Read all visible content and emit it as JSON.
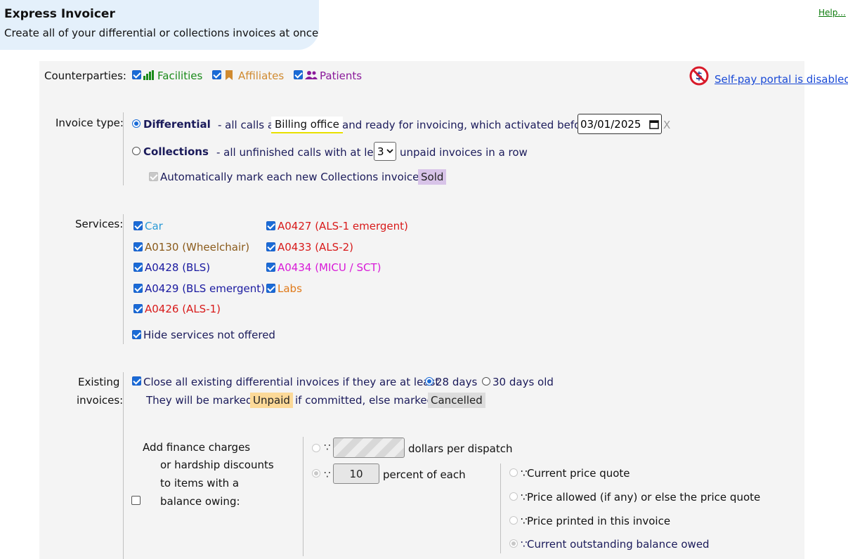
{
  "header": {
    "title": "Express Invoicer",
    "subtitle": "Create all of your differential or collections invoices at once",
    "help_link": "Help..."
  },
  "counterparties": {
    "label": "Counterparties:",
    "items": [
      {
        "label": "Facilities",
        "checked": true,
        "color": "#1a8a1a"
      },
      {
        "label": "Affiliates",
        "checked": true,
        "color": "#d08a30"
      },
      {
        "label": "Patients",
        "checked": true,
        "color": "#8a1a9a"
      }
    ],
    "selfpay_link": "Self-pay portal is disabled"
  },
  "invoice_type": {
    "label": "Invoice type:",
    "differential": {
      "title": "Differential",
      "text1": "- all calls at",
      "location": "Billing office",
      "text2": "and ready for invoicing, which activated before",
      "date": "03/01/2025",
      "clear": "X",
      "selected": true
    },
    "collections": {
      "title": "Collections",
      "text1": "- all unfinished calls with at least",
      "count": "3",
      "text2": "unpaid invoices in a row",
      "selected": false
    },
    "auto_mark": {
      "text": "Automatically mark each new Collections invoice as",
      "badge": "Sold"
    }
  },
  "services": {
    "label": "Services:",
    "col1": [
      {
        "label": "Car",
        "color": "#2a9ad6"
      },
      {
        "label": "A0130 (Wheelchair)",
        "color": "#8a5a1a"
      },
      {
        "label": "A0428 (BLS)",
        "color": "#1a1aa0"
      },
      {
        "label": "A0429 (BLS emergent)",
        "color": "#1a1aa0"
      },
      {
        "label": "A0426 (ALS-1)",
        "color": "#d81a1a"
      }
    ],
    "col2": [
      {
        "label": "A0427 (ALS-1 emergent)",
        "color": "#d81a1a"
      },
      {
        "label": "A0433 (ALS-2)",
        "color": "#d81a1a"
      },
      {
        "label": "A0434 (MICU / SCT)",
        "color": "#d81ad8"
      },
      {
        "label": "Labs",
        "color": "#e07a1a"
      }
    ],
    "hide_not_offered": "Hide services not offered"
  },
  "existing": {
    "label_line1": "Existing",
    "label_line2": "invoices:",
    "close_text": "Close all existing differential invoices if they are at least",
    "opt_28": "28 days",
    "opt_30": "30 days old",
    "marked_text1": "They will be marked",
    "unpaid_badge": "Unpaid",
    "marked_text2": "if committed, else marked",
    "cancelled_badge": "Cancelled"
  },
  "finance": {
    "line1": "Add finance charges",
    "line2": "or hardship discounts",
    "line3": "to items with a",
    "line4": "balance owing:",
    "dollars_text": "dollars per dispatch",
    "percent_value": "10",
    "percent_text": "percent of each",
    "drag_glyph": "∵",
    "bases": [
      "Current price quote",
      "Price allowed (if any) or else the price quote",
      "Price printed in this invoice",
      "Current outstanding balance owed"
    ]
  }
}
